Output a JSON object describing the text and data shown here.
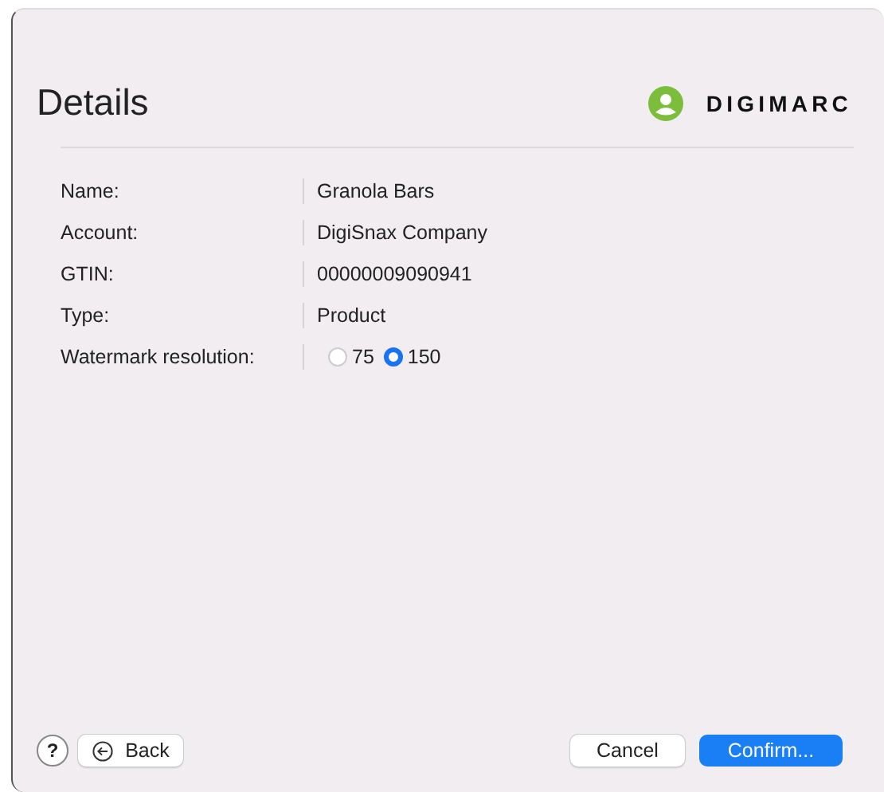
{
  "title": "Details",
  "logo": {
    "text": "DIGIMARC"
  },
  "fields": [
    {
      "kind": "text",
      "label": "Name:",
      "value": "Granola Bars"
    },
    {
      "kind": "text",
      "label": "Account:",
      "value": "DigiSnax Company"
    },
    {
      "kind": "text",
      "label": "GTIN:",
      "value": "00000009090941"
    },
    {
      "kind": "text",
      "label": "Type:",
      "value": "Product"
    },
    {
      "kind": "radio",
      "label": "Watermark resolution:",
      "options": [
        {
          "label": "75",
          "selected": false
        },
        {
          "label": "150",
          "selected": true
        }
      ]
    }
  ],
  "help": {
    "text": "?"
  },
  "buttons": {
    "back": "Back",
    "cancel": "Cancel",
    "confirm": "Confirm..."
  }
}
